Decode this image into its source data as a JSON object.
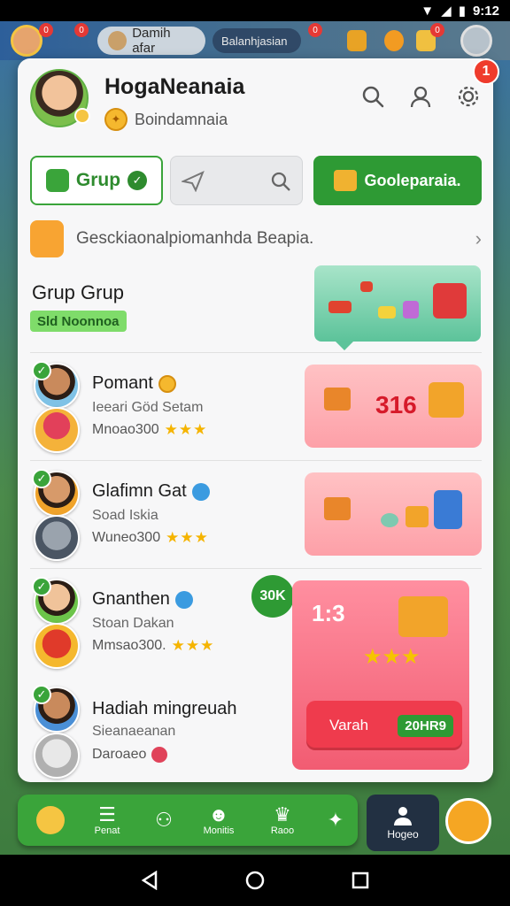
{
  "status_bar": {
    "time": "9:12"
  },
  "top_strip": {
    "badge_left": "0",
    "badge_left2": "0",
    "player_name": "Damih afar",
    "pill_text": "Balanhjasian",
    "badge_right": "0",
    "badge_right2": "0"
  },
  "panel": {
    "notif_count": "1",
    "profile": {
      "name": "HogaNeanaia",
      "subtitle": "Boindamnaia"
    },
    "actions": {
      "grup_label": "Grup",
      "green_button_label": "Gooleparaia."
    },
    "banner_text": "Gesckiaonalpiomanhda Beapia.",
    "section": {
      "title": "Grup Grup",
      "tag": "Sld Noonnoa"
    },
    "friends": [
      {
        "name": "Pomant",
        "sub": "Ieeari Göd Setam",
        "score": "Mnoao300",
        "reward": "316"
      },
      {
        "name": "Glafimn Gat",
        "sub": "Soad Iskia",
        "score": "Wuneo300",
        "reward": ""
      },
      {
        "name": "Gnanthen",
        "sub": "Stoan Dakan",
        "score": "Mmsao300.",
        "reward": "1:3",
        "badge": "30K"
      },
      {
        "name": "Hadiah mingreuah",
        "sub": "Sieanaeanan",
        "score": "Daroaeo",
        "reward": ""
      }
    ],
    "big_reward": {
      "claim_label": "Varah",
      "claim_tag": "20HR9"
    }
  },
  "bottom_nav": {
    "items": [
      {
        "label": ""
      },
      {
        "label": "Penat"
      },
      {
        "label": ""
      },
      {
        "label": "Monitis"
      },
      {
        "label": "Raoo"
      },
      {
        "label": ""
      }
    ],
    "active_label": "Hogeo"
  },
  "colors": {
    "accent_green": "#3aa43a",
    "alert_red": "#ef3b2c",
    "reward_pink": "#fda0a8"
  }
}
